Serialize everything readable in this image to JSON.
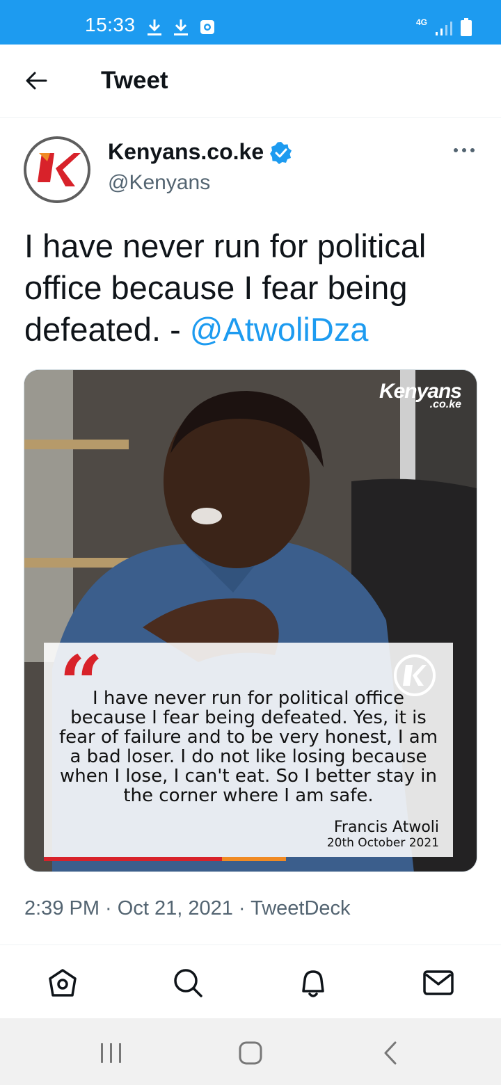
{
  "status_bar": {
    "time": "15:33",
    "network": "4G",
    "icons": [
      "download-icon",
      "download-icon",
      "screen-record-icon",
      "signal-icon",
      "battery-icon"
    ]
  },
  "header": {
    "title": "Tweet",
    "back_icon": "arrow-left-icon"
  },
  "tweet": {
    "author": {
      "display_name": "Kenyans.co.ke",
      "handle": "@Kenyans",
      "verified": true,
      "avatar_letter": "K"
    },
    "text": "I have never run for political office because I fear being defeated. - ",
    "mention": "@AtwoliDza",
    "media": {
      "logo_brand": "Kenyans",
      "logo_tld": ".co.ke",
      "quote_mark": "“",
      "quote_logo_letter": "K",
      "quote_text": "I have never run for political office because I fear being defeated. Yes, it is fear of failure and to be very honest, I am a bad loser. I do not like losing because when I lose, I can't eat. So I better stay in the corner where I am safe.",
      "attribution_name": "Francis Atwoli",
      "attribution_date": "20th October 2021"
    },
    "meta": {
      "time": "2:39 PM",
      "separator": " · ",
      "date": "Oct 21, 2021",
      "source": "TweetDeck"
    }
  },
  "bottom_nav": {
    "items": [
      "home-icon",
      "search-icon",
      "notifications-icon",
      "messages-icon"
    ]
  },
  "system_nav": {
    "items": [
      "recent-apps-icon",
      "home-button-icon",
      "back-chevron-icon"
    ]
  },
  "colors": {
    "status_bar": "#1d9bf0",
    "accent": "#1d9bf0",
    "brand_red": "#d8222a",
    "secondary_text": "#536471"
  }
}
